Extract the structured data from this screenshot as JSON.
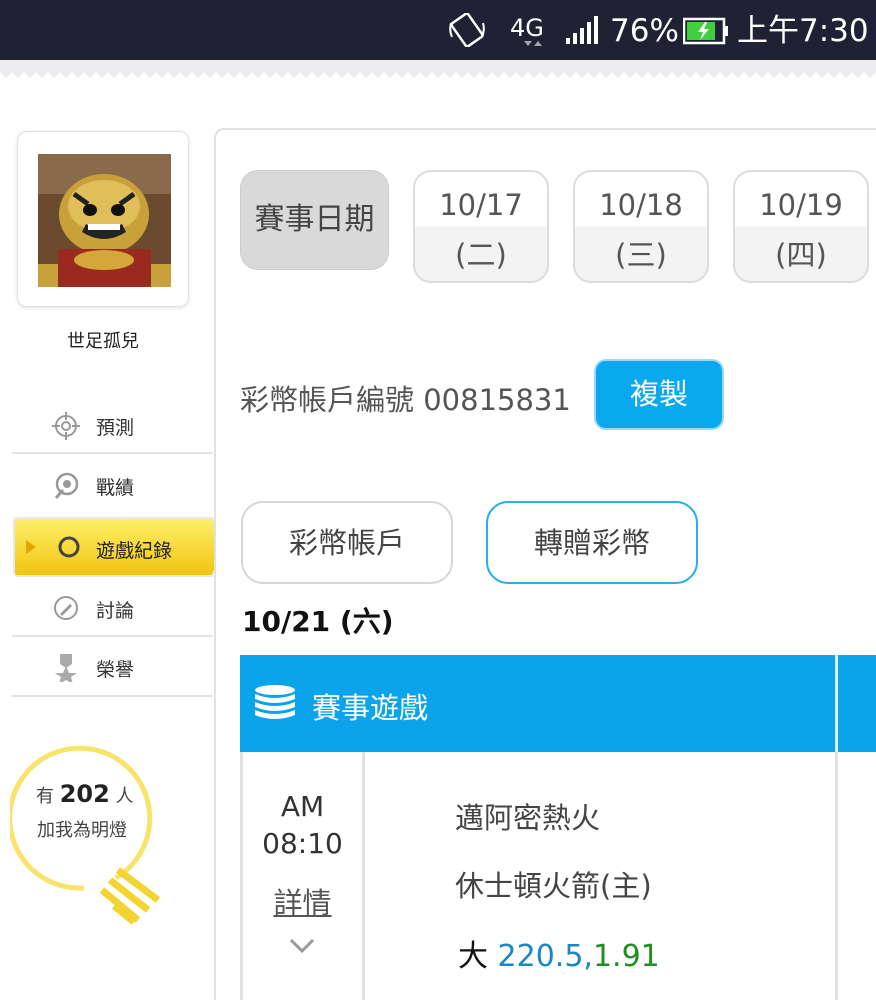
{
  "status_bar": {
    "network": "4G",
    "battery": "76%",
    "time": "上午7:30"
  },
  "sidebar": {
    "username": "世足孤兒",
    "items": [
      {
        "label": "預測",
        "icon": "target-icon"
      },
      {
        "label": "戰績",
        "icon": "record-icon"
      },
      {
        "label": "遊戲紀錄",
        "icon": "circle-icon",
        "active": true
      },
      {
        "label": "討論",
        "icon": "discuss-icon"
      },
      {
        "label": "榮譽",
        "icon": "medal-icon"
      }
    ],
    "fans": {
      "prefix": "有",
      "count": "202",
      "suffix": "人",
      "line2": "加我為明燈"
    }
  },
  "main": {
    "date_header": "賽事日期",
    "dates": [
      {
        "date": "10/17",
        "weekday": "(二)"
      },
      {
        "date": "10/18",
        "weekday": "(三)"
      },
      {
        "date": "10/19",
        "weekday": "(四)"
      }
    ],
    "account": {
      "text": "彩幣帳戶編號 00815831",
      "copy_label": "複製"
    },
    "tabs": {
      "wallet": "彩幣帳戶",
      "transfer": "轉贈彩幣"
    },
    "selected_date": "10/21 (六)",
    "table": {
      "title": "賽事遊戲",
      "row": {
        "ampm": "AM",
        "time": "08:10",
        "details": "詳情",
        "team1": "邁阿密熱火",
        "team2": "休士頓火箭(主)",
        "odds_label": "大",
        "odds_line": "220.5,",
        "odds_price": "1.91"
      }
    }
  },
  "colors": {
    "status_bar_bg": "#1f2235",
    "accent_blue": "#0ba4ea",
    "active_yellow": "#f6d21a",
    "odds_line": "#1a86c4",
    "odds_price": "#1f8f1f"
  }
}
